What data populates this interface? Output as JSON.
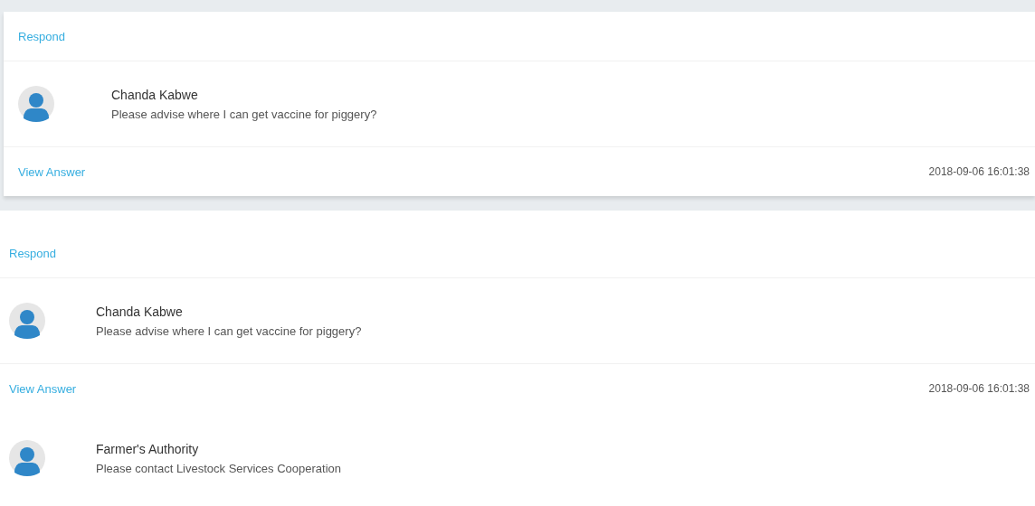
{
  "questions": [
    {
      "kind": "boxed",
      "respond": "Respond",
      "author": "Chanda Kabwe",
      "text": "Please advise where I can get vaccine for piggery?",
      "view_answer": "View Answer",
      "timestamp": "2018-09-06 16:01:38"
    },
    {
      "kind": "plain",
      "respond": "Respond",
      "author": "Chanda Kabwe",
      "text": "Please advise where I can get vaccine for piggery?",
      "view_answer": "View Answer",
      "timestamp": "2018-09-06 16:01:38",
      "answer": {
        "author": "Farmer's Authority",
        "text": "Please contact Livestock Services Cooperation"
      }
    }
  ]
}
